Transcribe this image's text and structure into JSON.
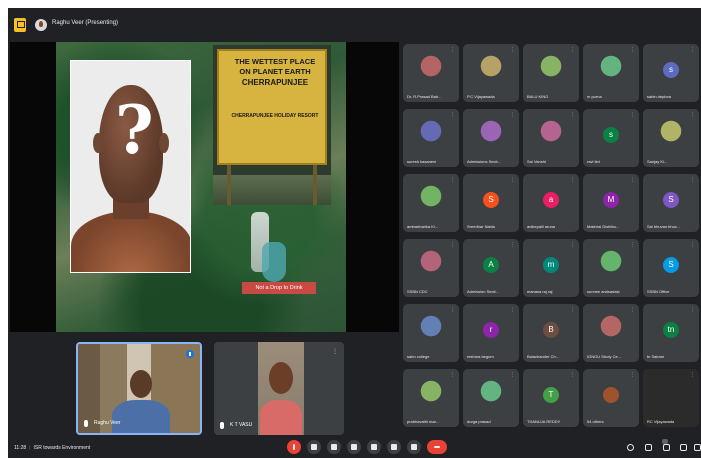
{
  "header": {
    "presenting_label": "Raghu Veer (Presenting)"
  },
  "slide": {
    "sign_lines": [
      "THE WETTEST PLACE",
      "ON PLANET EARTH",
      "CHERRAPUNJEE",
      "CHERRAPUNJEE HOLIDAY RESORT"
    ],
    "banner": "Not a Drop to Drink"
  },
  "cameras": [
    {
      "name": "Raghu Veer"
    },
    {
      "name": "K T VASU"
    }
  ],
  "participants": [
    {
      "name": "Dr. R.Prasad Bab...",
      "avatar_letter": "",
      "color": "#3c4043",
      "type": "photo"
    },
    {
      "name": "P.C.Vijayawada",
      "avatar_letter": "",
      "color": "#3c4043",
      "type": "photo"
    },
    {
      "name": "BALU KING",
      "avatar_letter": "",
      "color": "#3c4043",
      "type": "photo"
    },
    {
      "name": "m purna",
      "avatar_letter": "",
      "color": "#3c4043",
      "type": "photo"
    },
    {
      "name": "sabin deplora",
      "avatar_letter": "s",
      "color": "#5c6bc0",
      "type": "letter"
    },
    {
      "name": "suresh kasaneni",
      "avatar_letter": "",
      "color": "#3c4043",
      "type": "photo"
    },
    {
      "name": "Admissions Secti...",
      "avatar_letter": "",
      "color": "#3c4043",
      "type": "photo"
    },
    {
      "name": "Sai Vanshi",
      "avatar_letter": "",
      "color": "#3c4043",
      "type": "photo"
    },
    {
      "name": "ravi tkrl",
      "avatar_letter": "s",
      "color": "#0b8043",
      "type": "letter"
    },
    {
      "name": "Sanjay Ki...",
      "avatar_letter": "",
      "color": "#3c4043",
      "type": "photo"
    },
    {
      "name": "ambariharika Ki...",
      "avatar_letter": "",
      "color": "#3c4043",
      "type": "photo"
    },
    {
      "name": "Sreedhar Naidu",
      "avatar_letter": "S",
      "color": "#f4511e",
      "type": "letter"
    },
    {
      "name": "anikepalli aruna",
      "avatar_letter": "a",
      "color": "#e91e63",
      "type": "letter"
    },
    {
      "name": "Material Distribu...",
      "avatar_letter": "M",
      "color": "#8e24aa",
      "type": "letter"
    },
    {
      "name": "Sai bhuvan bhuv...",
      "avatar_letter": "S",
      "color": "#7e57c2",
      "type": "letter"
    },
    {
      "name": "SSBN CDC",
      "avatar_letter": "",
      "color": "#3c4043",
      "type": "photo"
    },
    {
      "name": "Admission Secti...",
      "avatar_letter": "A",
      "color": "#0b8043",
      "type": "letter"
    },
    {
      "name": "manasa raj raj",
      "avatar_letter": "m",
      "color": "#00897b",
      "type": "letter"
    },
    {
      "name": "sunnee andsadasi",
      "avatar_letter": "",
      "color": "#3c4043",
      "type": "photo"
    },
    {
      "name": "SSBN Office",
      "avatar_letter": "S",
      "color": "#039be5",
      "type": "letter"
    },
    {
      "name": "sabn college",
      "avatar_letter": "",
      "color": "#3c4043",
      "type": "photo"
    },
    {
      "name": "reshma begum",
      "avatar_letter": "r",
      "color": "#8e24aa",
      "type": "letter"
    },
    {
      "name": "Balachander Ch...",
      "avatar_letter": "B",
      "color": "#6d4c41",
      "type": "letter"
    },
    {
      "name": "IGNOU Study Ce...",
      "avatar_letter": "",
      "color": "#3c4043",
      "type": "photo"
    },
    {
      "name": "tn Sairam",
      "avatar_letter": "tn",
      "color": "#0b8043",
      "type": "letter"
    },
    {
      "name": "prabhavathi mar...",
      "avatar_letter": "",
      "color": "#3c4043",
      "type": "photo"
    },
    {
      "name": "durga prasad",
      "avatar_letter": "",
      "color": "#3c4043",
      "type": "photo"
    },
    {
      "name": "THANUJA REDDY",
      "avatar_letter": "T",
      "color": "#43a047",
      "type": "letter"
    },
    {
      "name": "54 others",
      "avatar_letter": "",
      "color": "#3c4043",
      "type": "others"
    },
    {
      "name": "RC Vijayawada",
      "avatar_letter": "",
      "color": "#2b2b2b",
      "type": "dark"
    }
  ],
  "footer": {
    "time": "11:28",
    "meeting_name": "ISR towards Environment",
    "participants_badge": "86"
  }
}
